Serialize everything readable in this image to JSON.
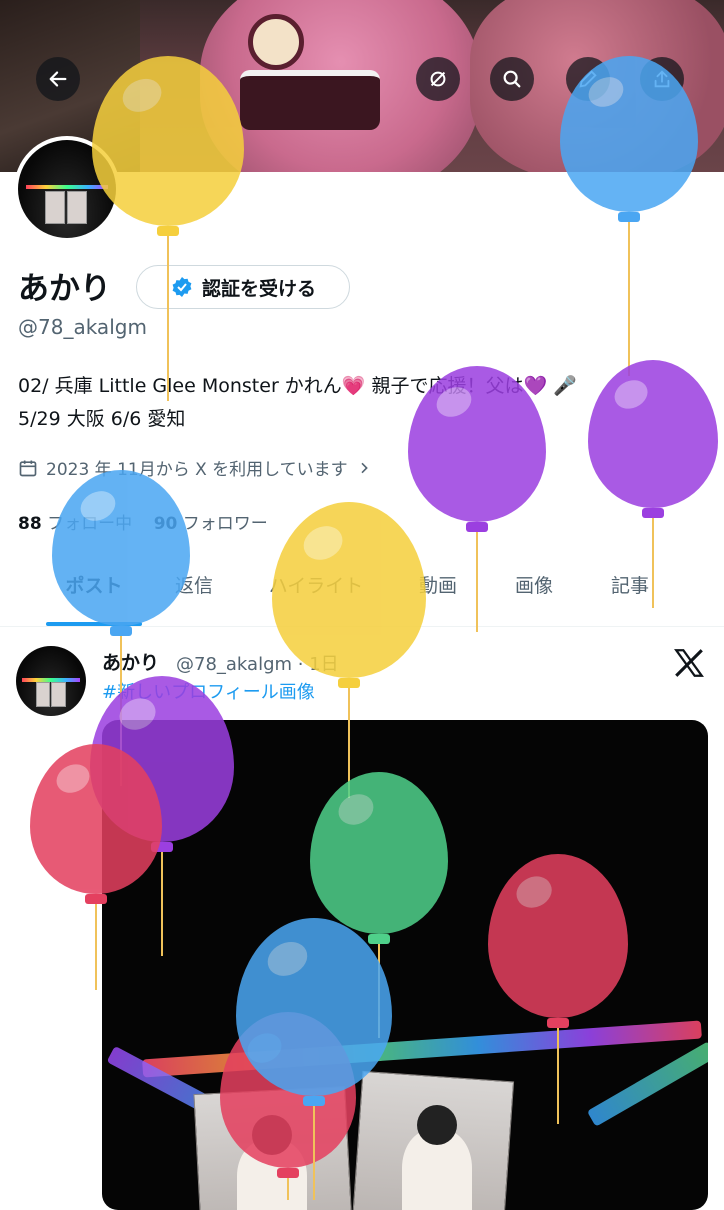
{
  "header": {
    "back_icon": "arrow-left-icon",
    "grok_icon": "grok-icon",
    "search_icon": "search-icon",
    "edit_icon": "pencil-icon",
    "share_icon": "share-icon"
  },
  "profile": {
    "name": "あかり",
    "verify_button": "認証を受ける",
    "handle": "@78_akalgm",
    "bio_line1": "02/ 兵庫 Little Glee Monster かれん💗 親子で応援！父は💜 🎤",
    "bio_line2": "5/29 大阪 6/6 愛知",
    "joined": "2023 年 11月から X を利用しています",
    "following_count": "88",
    "following_label": "フォロー中",
    "followers_count": "90",
    "followers_label": "フォロワー"
  },
  "tabs": [
    {
      "label": "ポスト",
      "active": true
    },
    {
      "label": "返信",
      "active": false
    },
    {
      "label": "ハイライト",
      "active": false
    },
    {
      "label": "動画",
      "active": false
    },
    {
      "label": "画像",
      "active": false
    },
    {
      "label": "記事",
      "active": false
    }
  ],
  "post": {
    "author": "あかり",
    "handle_time": "@78_akalgm · 1日",
    "hashtag": "#新しいプロフィール画像"
  },
  "colors": {
    "accent": "#1d9bf0",
    "balloon_yellow": "#f5cf3d",
    "balloon_blue": "#4aa6f2",
    "balloon_purple": "#9b3fe0",
    "balloon_red": "#e4405f",
    "balloon_green": "#4fd08a"
  }
}
